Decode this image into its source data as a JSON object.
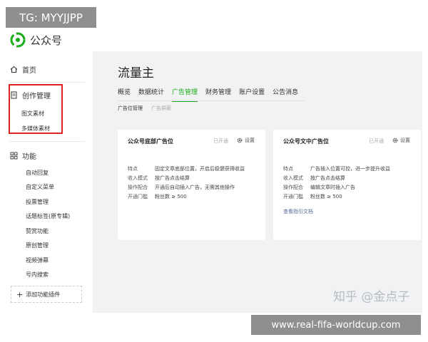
{
  "overlay": {
    "tag": "TG: MYYJJPP",
    "url": "www.real-fifa-worldcup.com",
    "zhihu": "知乎 @金点子"
  },
  "brand": {
    "name": "公众号",
    "color": "#1aad19"
  },
  "sidebar": {
    "home": "首页",
    "creation": "创作管理",
    "creation_items": [
      "图文素材",
      "多媒体素材"
    ],
    "features": "功能",
    "feature_items": [
      "自动回复",
      "自定义菜单",
      "投票管理",
      "话题标签(原专辑)",
      "赞赏功能",
      "原创管理",
      "视频弹幕",
      "号内搜索"
    ],
    "add_plugin": "添加功能插件"
  },
  "main": {
    "title": "流量主",
    "tabs": [
      "概览",
      "数据统计",
      "广告管理",
      "财务管理",
      "账户设置",
      "公告消息"
    ],
    "active_tab": "广告管理",
    "subtabs": [
      "广告位管理",
      "广告屏蔽"
    ],
    "cards": [
      {
        "title": "公众号底部广告位",
        "status": "已开通",
        "settings": "设置",
        "rows": [
          {
            "k": "特点",
            "v": "固定文章底部位置，开启后稳健获得收益"
          },
          {
            "k": "收入模式",
            "v": "按广告点击结算"
          },
          {
            "k": "操作配合",
            "v": "开通后自动插入广告，无需其他操作"
          },
          {
            "k": "开通门槛",
            "v": "粉丝数 ≥ 500"
          }
        ]
      },
      {
        "title": "公众号文中广告位",
        "status": "已开通",
        "settings": "设置",
        "rows": [
          {
            "k": "特点",
            "v": "广告插入位置可控，进一步提升收益"
          },
          {
            "k": "收入模式",
            "v": "按广告点击结算"
          },
          {
            "k": "操作配合",
            "v": "编辑文章时插入广告"
          },
          {
            "k": "开通门槛",
            "v": "粉丝数 ≥ 500"
          }
        ],
        "link": "查看指引文档"
      }
    ]
  }
}
